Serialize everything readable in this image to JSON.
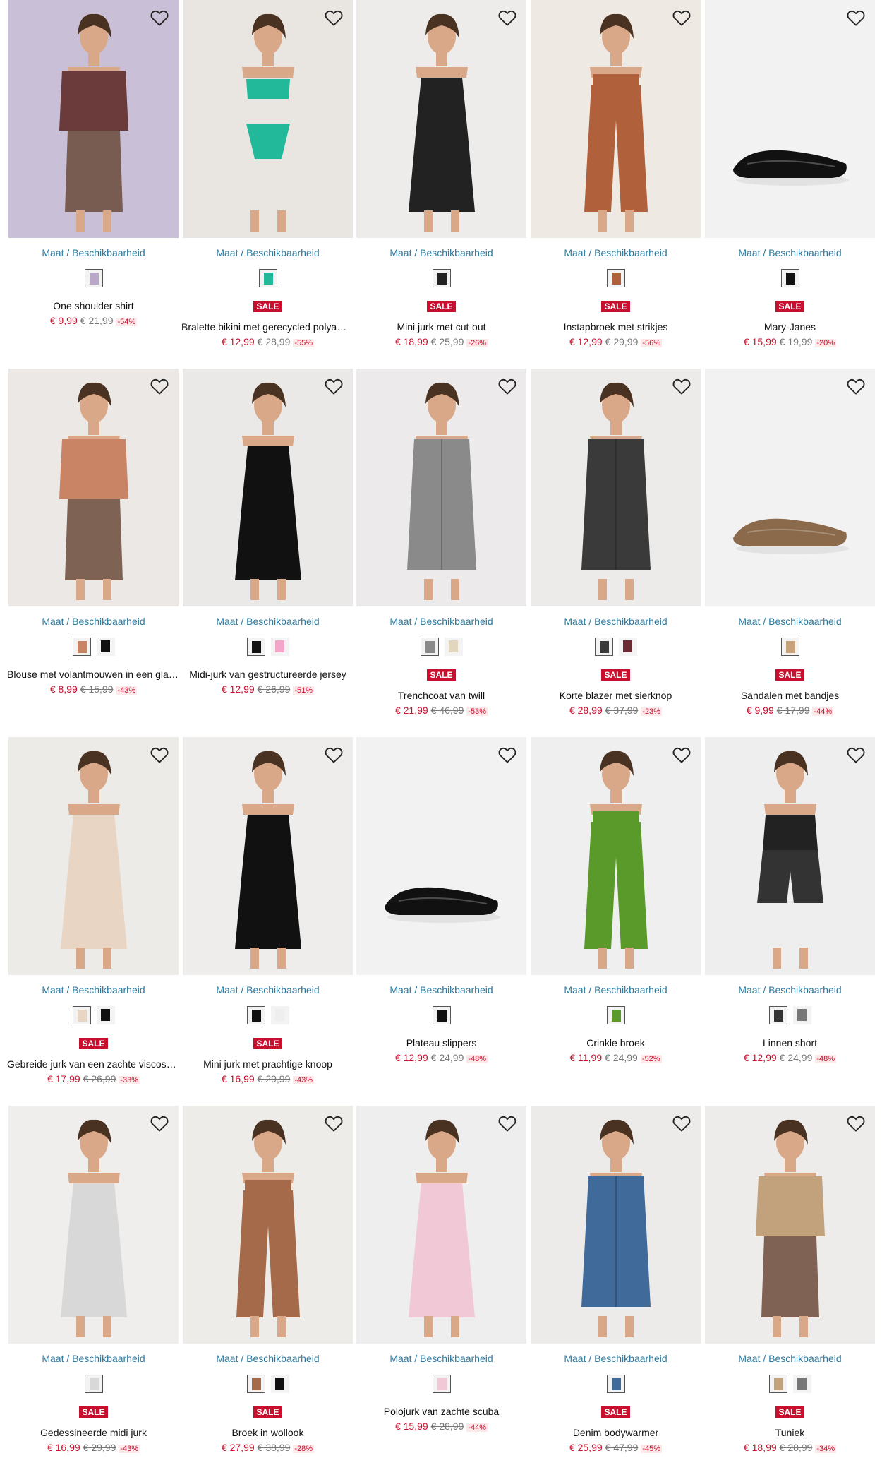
{
  "size_link": "Maat / Beschikbaarheid",
  "sale_badge": "SALE",
  "products": [
    {
      "title": "One shoulder shirt",
      "price": "€ 9,99",
      "was": "€ 21,99",
      "discount": "-54%",
      "sale": false,
      "img": "#c9bfd6",
      "accent": "#6b3a3a",
      "icon": "top",
      "swatches": [
        "#b9a7c8"
      ]
    },
    {
      "title": "Bralette bikini met gerecycled polyamide",
      "price": "€ 12,99",
      "was": "€ 28,99",
      "discount": "-55%",
      "sale": true,
      "img": "#e9e6e2",
      "accent": "#22b89a",
      "icon": "bikini",
      "swatches": [
        "#22b89a"
      ]
    },
    {
      "title": "Mini jurk met cut-out",
      "price": "€ 18,99",
      "was": "€ 25,99",
      "discount": "-26%",
      "sale": true,
      "img": "#eeeceb",
      "accent": "#222222",
      "icon": "dress",
      "swatches": [
        "#222222"
      ]
    },
    {
      "title": "Instapbroek met strikjes",
      "price": "€ 12,99",
      "was": "€ 29,99",
      "discount": "-56%",
      "sale": true,
      "img": "#efe9e4",
      "accent": "#b0603a",
      "icon": "pants",
      "swatches": [
        "#b0603a"
      ]
    },
    {
      "title": "Mary-Janes",
      "price": "€ 15,99",
      "was": "€ 19,99",
      "discount": "-20%",
      "sale": true,
      "img": "#f2f2f2",
      "accent": "#111111",
      "icon": "shoe",
      "swatches": [
        "#111111"
      ]
    },
    {
      "title": "Blouse met volantmouwen in een glanzende look",
      "price": "€ 8,99",
      "was": "€ 15,99",
      "discount": "-43%",
      "sale": false,
      "img": "#ebe8e5",
      "accent": "#c98466",
      "icon": "top",
      "swatches": [
        "#c98466",
        "#111111"
      ]
    },
    {
      "title": "Midi-jurk van gestructureerde jersey",
      "price": "€ 12,99",
      "was": "€ 26,99",
      "discount": "-51%",
      "sale": false,
      "img": "#ebe9e7",
      "accent": "#111111",
      "icon": "dress",
      "swatches": [
        "#111111",
        "#f3a6c8"
      ]
    },
    {
      "title": "Trenchcoat van twill",
      "price": "€ 21,99",
      "was": "€ 46,99",
      "discount": "-53%",
      "sale": true,
      "img": "#eceaea",
      "accent": "#8a8a8a",
      "icon": "coat",
      "swatches": [
        "#8a8a8a",
        "#e2d6bf"
      ]
    },
    {
      "title": "Korte blazer met sierknop",
      "price": "€ 28,99",
      "was": "€ 37,99",
      "discount": "-23%",
      "sale": true,
      "img": "#ecebea",
      "accent": "#3a3a3a",
      "icon": "coat",
      "swatches": [
        "#3a3a3a",
        "#6b2a34"
      ]
    },
    {
      "title": "Sandalen met bandjes",
      "price": "€ 9,99",
      "was": "€ 17,99",
      "discount": "-44%",
      "sale": true,
      "img": "#f2f2f2",
      "accent": "#8a6a4a",
      "icon": "shoe",
      "swatches": [
        "#c8a27a"
      ]
    },
    {
      "title": "Gebreide jurk van een zachte viscose mix",
      "price": "€ 17,99",
      "was": "€ 26,99",
      "discount": "-33%",
      "sale": true,
      "img": "#ecebe8",
      "accent": "#e8d5c4",
      "icon": "dress",
      "swatches": [
        "#e8d5c4",
        "#111111"
      ]
    },
    {
      "title": "Mini jurk met prachtige knoop",
      "price": "€ 16,99",
      "was": "€ 29,99",
      "discount": "-43%",
      "sale": true,
      "img": "#eeedeb",
      "accent": "#111111",
      "icon": "dress",
      "swatches": [
        "#111111",
        "#eeeeee"
      ]
    },
    {
      "title": "Plateau slippers",
      "price": "€ 12,99",
      "was": "€ 24,99",
      "discount": "-48%",
      "sale": false,
      "img": "#f2f2f2",
      "accent": "#111111",
      "icon": "shoe",
      "swatches": [
        "#111111"
      ]
    },
    {
      "title": "Crinkle broek",
      "price": "€ 11,99",
      "was": "€ 24,99",
      "discount": "-52%",
      "sale": false,
      "img": "#efefef",
      "accent": "#5a9a2a",
      "icon": "pants",
      "swatches": [
        "#5a9a2a"
      ]
    },
    {
      "title": "Linnen short",
      "price": "€ 12,99",
      "was": "€ 24,99",
      "discount": "-48%",
      "sale": false,
      "img": "#eeeeee",
      "accent": "#333333",
      "icon": "short",
      "swatches": [
        "#333333",
        "#777777"
      ]
    },
    {
      "title": "Gedessineerde midi jurk",
      "price": "€ 16,99",
      "was": "€ 29,99",
      "discount": "-43%",
      "sale": true,
      "img": "#efeeec",
      "accent": "#d8d8d8",
      "icon": "dress",
      "swatches": [
        "#d8d8d8"
      ]
    },
    {
      "title": "Broek in wollook",
      "price": "€ 27,99",
      "was": "€ 38,99",
      "discount": "-28%",
      "sale": true,
      "img": "#eeece9",
      "accent": "#a46a4a",
      "icon": "pants",
      "swatches": [
        "#a46a4a",
        "#111111"
      ]
    },
    {
      "title": "Polojurk van zachte scuba",
      "price": "€ 15,99",
      "was": "€ 28,99",
      "discount": "-44%",
      "sale": false,
      "img": "#efeeee",
      "accent": "#f1c8d6",
      "icon": "dress",
      "swatches": [
        "#f1c8d6"
      ]
    },
    {
      "title": "Denim bodywarmer",
      "price": "€ 25,99",
      "was": "€ 47,99",
      "discount": "-45%",
      "sale": true,
      "img": "#ecebea",
      "accent": "#3f6a9a",
      "icon": "coat",
      "swatches": [
        "#3f6a9a"
      ]
    },
    {
      "title": "Tuniek",
      "price": "€ 18,99",
      "was": "€ 28,99",
      "discount": "-34%",
      "sale": true,
      "img": "#edecea",
      "accent": "#c2a27c",
      "icon": "top",
      "swatches": [
        "#c2a27c",
        "#777777"
      ]
    }
  ]
}
